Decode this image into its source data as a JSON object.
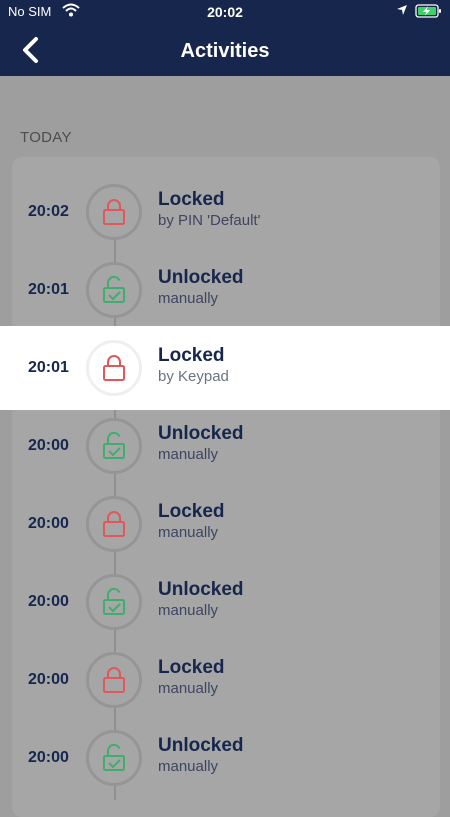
{
  "status_bar": {
    "carrier": "No SIM",
    "time": "20:02"
  },
  "header": {
    "title": "Activities"
  },
  "section_label": "TODAY",
  "colors": {
    "navy": "#16264d",
    "locked": "#e0585a",
    "unlocked": "#3fae6c"
  },
  "activities": [
    {
      "time": "20:02",
      "label": "Locked",
      "detail": "by PIN 'Default'",
      "icon": "padlock-locked-icon"
    },
    {
      "time": "20:01",
      "label": "Unlocked",
      "detail": "manually",
      "icon": "padlock-unlocked-icon"
    },
    {
      "time": "20:01",
      "label": "Locked",
      "detail": "by Keypad",
      "icon": "padlock-locked-icon"
    },
    {
      "time": "20:00",
      "label": "Unlocked",
      "detail": "manually",
      "icon": "padlock-unlocked-icon"
    },
    {
      "time": "20:00",
      "label": "Locked",
      "detail": "manually",
      "icon": "padlock-locked-icon"
    },
    {
      "time": "20:00",
      "label": "Unlocked",
      "detail": "manually",
      "icon": "padlock-unlocked-icon"
    },
    {
      "time": "20:00",
      "label": "Locked",
      "detail": "manually",
      "icon": "padlock-locked-icon"
    },
    {
      "time": "20:00",
      "label": "Unlocked",
      "detail": "manually",
      "icon": "padlock-unlocked-icon"
    }
  ]
}
